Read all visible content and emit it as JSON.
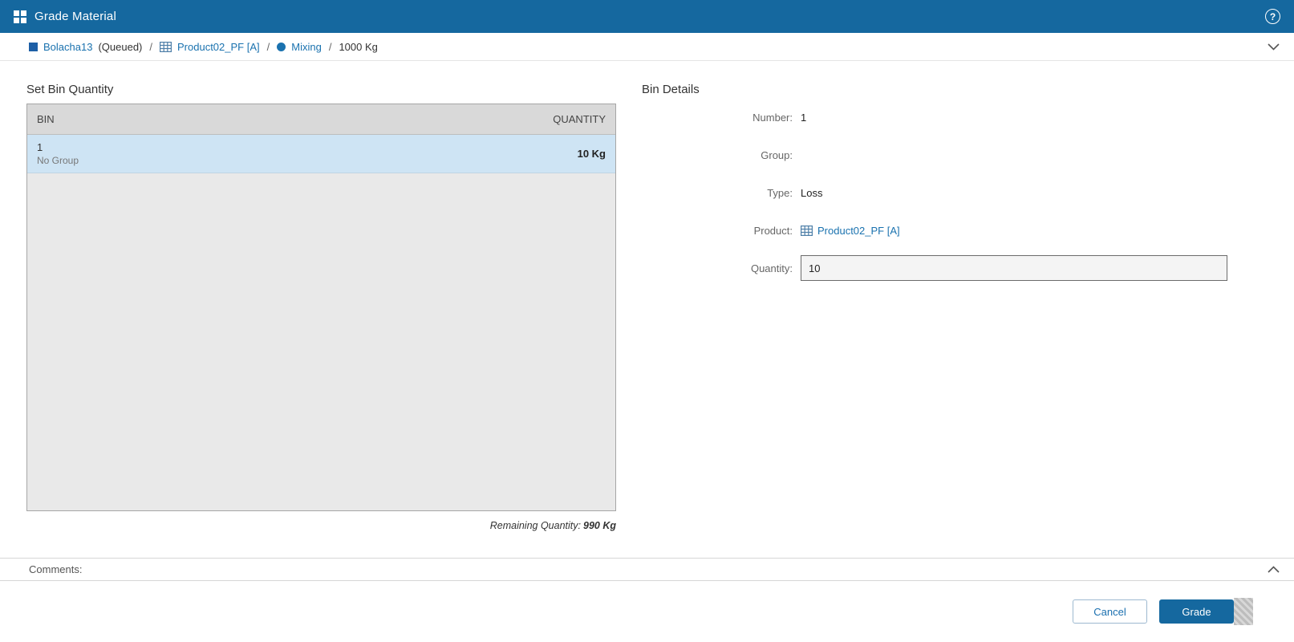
{
  "header": {
    "title": "Grade Material"
  },
  "icons": {
    "help_glyph": "?"
  },
  "breadcrumb": {
    "order": "Bolacha13",
    "status": "(Queued)",
    "sep1": "/",
    "product": "Product02_PF [A]",
    "sep2": "/",
    "operation": "Mixing",
    "sep3": "/",
    "quantity": "1000 Kg"
  },
  "bin_table": {
    "title": "Set Bin Quantity",
    "columns": {
      "bin": "BIN",
      "quantity": "QUANTITY"
    },
    "rows": [
      {
        "number": "1",
        "group": "No Group",
        "quantity": "10 Kg"
      }
    ],
    "remaining_label": "Remaining Quantity:",
    "remaining_value": "990 Kg"
  },
  "bin_details": {
    "title": "Bin Details",
    "number_label": "Number:",
    "number_value": "1",
    "group_label": "Group:",
    "group_value": "",
    "type_label": "Type:",
    "type_value": "Loss",
    "product_label": "Product:",
    "product_value": "Product02_PF [A]",
    "quantity_label": "Quantity:",
    "quantity_value": "10"
  },
  "comments": {
    "label": "Comments:"
  },
  "footer": {
    "cancel_label": "Cancel",
    "grade_label": "Grade"
  },
  "colors": {
    "header_bg": "#15689F",
    "link": "#1A72AF",
    "selected_row": "#CEE4F4",
    "grade_button": "#15689F"
  }
}
